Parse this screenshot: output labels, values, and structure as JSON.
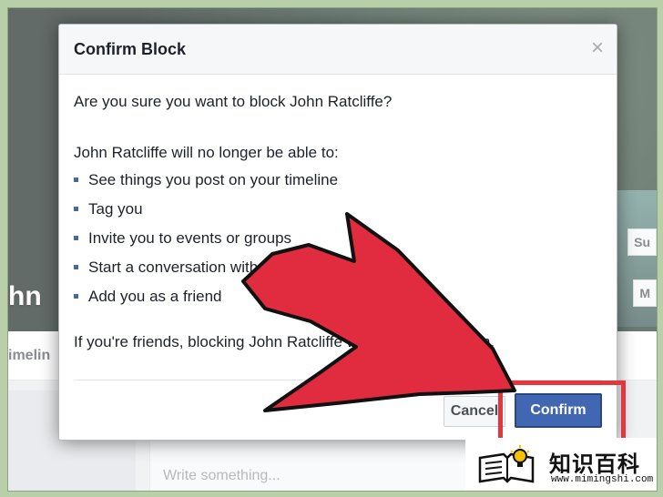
{
  "background": {
    "profile_name_fragment": "hn",
    "side_button_a": "Su",
    "side_button_b": "M",
    "tab_timeline": "imelin",
    "composer_placeholder": "Write something..."
  },
  "dialog": {
    "title": "Confirm Block",
    "close_symbol": "×",
    "question": "Are you sure you want to block John Ratcliffe?",
    "intro": "John Ratcliffe will no longer be able to:",
    "items": [
      "See things you post on your timeline",
      "Tag you",
      "Invite you to events or groups",
      "Start a conversation with you",
      "Add you as a friend"
    ],
    "friends_note": "If you're friends, blocking John Ratcliffe will also unfriend him.",
    "cancel_label": "Cancel",
    "confirm_label": "Confirm"
  },
  "colors": {
    "confirm_button": "#4267b2",
    "highlight": "#e2373f",
    "arrow": "#e12c3f",
    "bullet": "#4b67a1"
  },
  "watermark": {
    "brand": "知识百科",
    "url": "www.mimingshi.com"
  }
}
